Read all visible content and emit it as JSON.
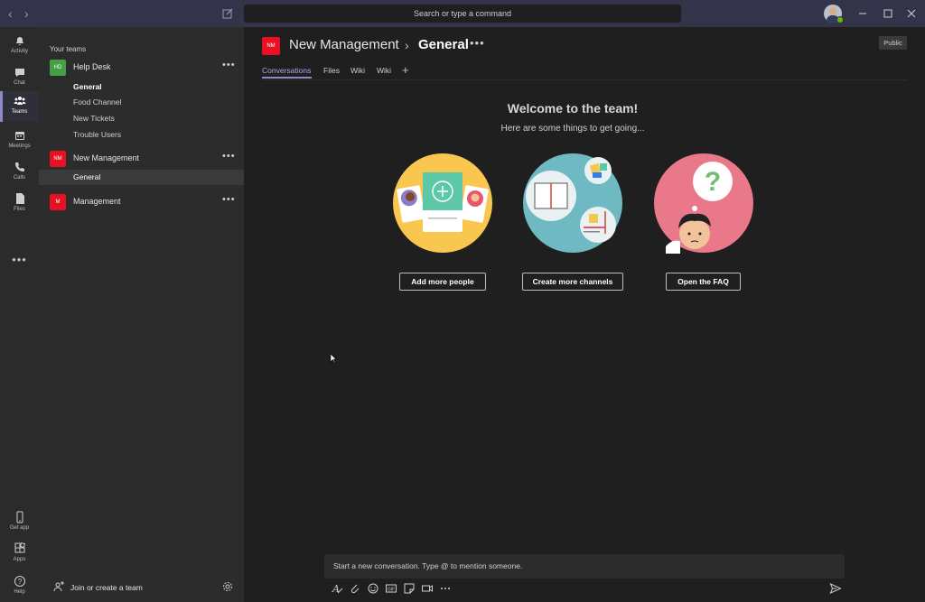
{
  "titlebar": {
    "back_glyph": "‹",
    "forward_glyph": "›",
    "search_placeholder": "Search or type a command",
    "icons": [
      "back-icon",
      "forward-icon",
      "compose-icon",
      "minimize-icon",
      "maximize-icon",
      "close-icon"
    ]
  },
  "appbar": {
    "items": [
      {
        "label": "Activity",
        "icon": "bell-icon"
      },
      {
        "label": "Chat",
        "icon": "chat-icon"
      },
      {
        "label": "Teams",
        "icon": "teams-icon",
        "active": true
      },
      {
        "label": "Meetings",
        "icon": "calendar-icon"
      },
      {
        "label": "Calls",
        "icon": "phone-icon"
      },
      {
        "label": "Files",
        "icon": "file-icon"
      }
    ],
    "more": "•••",
    "bottom_items": [
      {
        "label": "Get app",
        "icon": "mobile-icon"
      },
      {
        "label": "Apps",
        "icon": "apps-icon"
      },
      {
        "label": "Help",
        "icon": "help-icon"
      }
    ]
  },
  "teams_panel": {
    "heading": "Your teams",
    "teams": [
      {
        "initials": "HD",
        "name": "Help Desk",
        "color": "#43a047",
        "channels": [
          "General",
          "Food Channel",
          "New Tickets",
          "Trouble Users"
        ]
      },
      {
        "initials": "NM",
        "name": "New Management",
        "color": "#e81123",
        "channels": [
          "General"
        ]
      },
      {
        "initials": "M",
        "name": "Management",
        "color": "#e81123",
        "channels": []
      }
    ],
    "more_glyph": "•••",
    "join_label": "Join or create a team"
  },
  "main": {
    "team_initials": "NM",
    "team_name": "New Management",
    "separator": "›",
    "channel_name": "General",
    "more_glyph": "•••",
    "badge": "Public",
    "tabs": [
      "Conversations",
      "Files",
      "Wiki",
      "Wiki"
    ],
    "add_tab": "+",
    "welcome_title": "Welcome to the team!",
    "welcome_subtitle": "Here are some things to get going...",
    "actions": [
      "Add more people",
      "Create more channels",
      "Open the FAQ"
    ],
    "compose_placeholder": "Start a new conversation. Type @ to mention someone.",
    "compose_tools": [
      "format-icon",
      "attach-icon",
      "emoji-icon",
      "gif-icon",
      "sticker-icon",
      "meet-icon",
      "more-icon"
    ]
  },
  "colors": {
    "accent": "#8b8cc7",
    "titlebar": "#33344a",
    "presence": "#6bb700"
  }
}
